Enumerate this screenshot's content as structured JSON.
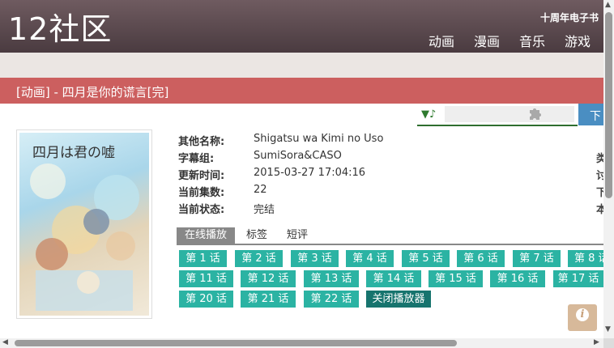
{
  "header": {
    "logo": "12社区",
    "anniversary": "十周年电子书",
    "nav": [
      "动画",
      "漫画",
      "音乐",
      "游戏"
    ]
  },
  "page_title": "[动画] - 四月是你的谎言[完]",
  "download_label": "下",
  "cover": {
    "title_text": "四月は君の嘘"
  },
  "info": [
    {
      "label": "其他名称:",
      "value": "Shigatsu wa Kimi no Uso"
    },
    {
      "label": "字幕组:",
      "value": "SumiSora&CASO"
    },
    {
      "label": "更新时间:",
      "value": "2015-03-27 17:04:16"
    },
    {
      "label": "当前集数:",
      "value": "22"
    },
    {
      "label": "当前状态:",
      "value": "完结"
    }
  ],
  "right_chars": [
    "类",
    "讨",
    "下",
    "本"
  ],
  "tabs": [
    "在线播放",
    "标签",
    "短评"
  ],
  "episodes": {
    "row1": [
      "第 1 话",
      "第 2 话",
      "第 3 话",
      "第 4 话",
      "第 5 话",
      "第 6 话",
      "第 7 话",
      "第 8 话"
    ],
    "row2": [
      "第 11 话",
      "第 12 话",
      "第 13 话",
      "第 14 话",
      "第 15 话",
      "第 16 话",
      "第 17 话"
    ],
    "row3": [
      "第 20 话",
      "第 21 话",
      "第 22 话"
    ],
    "close_player": "关闭播放器"
  },
  "colors": {
    "header_bg": "#5e4c51",
    "title_bar": "#cc5f5f",
    "episode_button": "#2bb3a3",
    "close_button": "#17746e",
    "download_button": "#4a8ec2"
  },
  "icons": [
    "music-note-icon",
    "puzzle-icon",
    "info-icon"
  ]
}
